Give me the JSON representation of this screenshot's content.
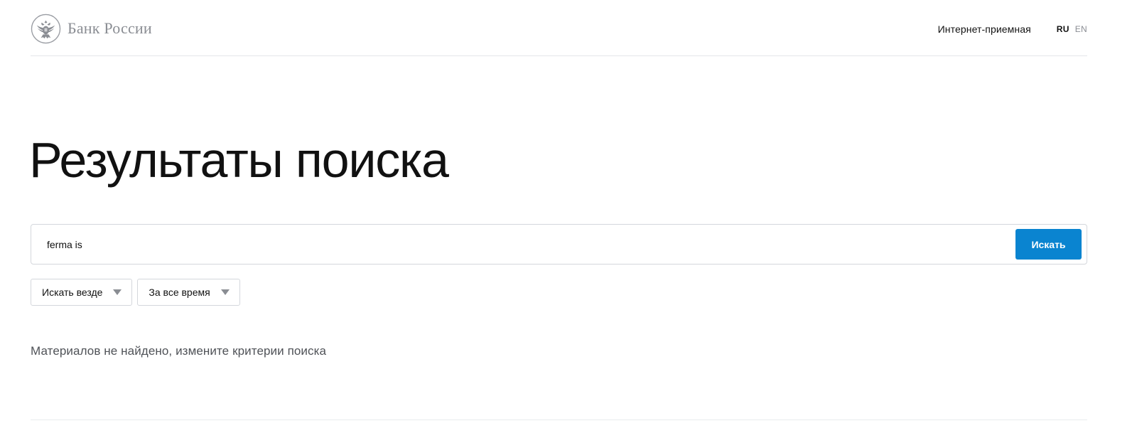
{
  "header": {
    "logo_text": "Банк России",
    "logo_icon": "double-headed-eagle-emblem",
    "reception_link": "Интернет-приемная",
    "languages": [
      {
        "code": "RU",
        "active": true
      },
      {
        "code": "EN",
        "active": false
      }
    ]
  },
  "page": {
    "title": "Результаты поиска"
  },
  "search": {
    "query": "ferma is",
    "button_label": "Искать",
    "button_color": "#0a84d0"
  },
  "filters": [
    {
      "label": "Искать везде",
      "icon": "caret-down-icon"
    },
    {
      "label": "За все время",
      "icon": "caret-down-icon"
    }
  ],
  "results": {
    "empty_message": "Материалов не найдено, измените критерии поиска"
  }
}
